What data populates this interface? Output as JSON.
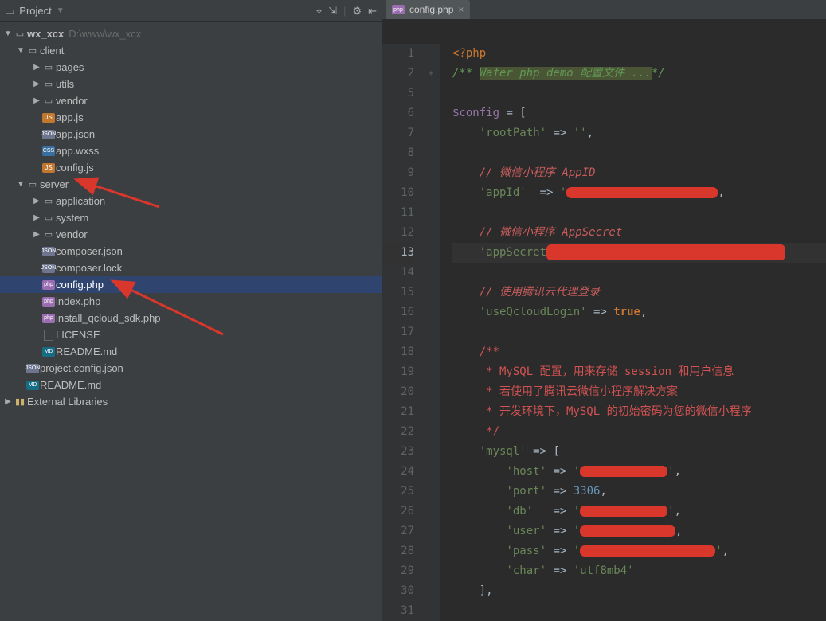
{
  "sidebar": {
    "title": "Project",
    "tool_icons": [
      "target-icon",
      "collapse-icon",
      "gear-icon",
      "hide-icon"
    ]
  },
  "tree": {
    "root": {
      "label": "wx_xcx",
      "hint": "D:\\www\\wx_xcx"
    },
    "client": {
      "label": "client"
    },
    "client_items": {
      "pages": "pages",
      "utils": "utils",
      "vendor": "vendor",
      "app_js": "app.js",
      "app_json": "app.json",
      "app_wxss": "app.wxss",
      "config_js": "config.js"
    },
    "server": {
      "label": "server"
    },
    "server_items": {
      "application": "application",
      "system": "system",
      "vendor": "vendor",
      "composer_json": "composer.json",
      "composer_lock": "composer.lock",
      "config_php": "config.php",
      "index_php": "index.php",
      "install_sdk": "install_qcloud_sdk.php",
      "license": "LICENSE",
      "readme_md": "README.md"
    },
    "root_files": {
      "project_config": "project.config.json",
      "readme_md": "README.md"
    },
    "external_libs": "External Libraries"
  },
  "tab": {
    "label": "config.php"
  },
  "code": {
    "line_start": 1,
    "l1": "<?php",
    "l2_fold": "+",
    "l2_a": "/** ",
    "l2_b": "Wafer php demo 配置文件 ...",
    "l2_c": "*/",
    "l5": "",
    "l6a": "$config",
    "l6b": " = [",
    "l7a": "'rootPath'",
    "l7b": " => ",
    "l7c": "''",
    "l7d": ",",
    "l8": "",
    "l9": "// 微信小程序 AppID",
    "l10a": "'appId'",
    "l10b": "  => ",
    "l10c": "'",
    "l10d": "",
    "l10e": ",",
    "l11": "",
    "l12": "// 微信小程序 AppSecret",
    "l13a": "'appSecret",
    "l14": "",
    "l15": "// 使用腾讯云代理登录",
    "l16a": "'useQcloudLogin'",
    "l16b": " => ",
    "l16c": "true",
    "l16d": ",",
    "l17": "",
    "l18": "/**",
    "l19": " * MySQL 配置，用来存储 session 和用户信息",
    "l20": " * 若使用了腾讯云微信小程序解决方案",
    "l21": " * 开发环境下，MySQL 的初始密码为您的微信小程序",
    "l22": " */",
    "l23a": "'mysql'",
    "l23b": " => [",
    "l24a": "'host'",
    "l24b": " => ",
    "l24c": "'",
    "l24d": "'",
    "l24e": ",",
    "l25a": "'port'",
    "l25b": " => ",
    "l25c": "3306",
    "l25d": ",",
    "l26a": "'db'",
    "l26b": "   => ",
    "l26c": "'",
    "l26d": "'",
    "l26e": ",",
    "l27a": "'user'",
    "l27b": " => ",
    "l27c": "'",
    "l27d": ",",
    "l28a": "'pass'",
    "l28b": " => ",
    "l28c": "'",
    "l28d": "'",
    "l28e": ",",
    "l29a": "'char'",
    "l29b": " => ",
    "l29c": "'utf8mb4'",
    "l30": "],"
  },
  "line_numbers": [
    1,
    2,
    5,
    6,
    7,
    8,
    9,
    10,
    11,
    12,
    13,
    14,
    15,
    16,
    17,
    18,
    19,
    20,
    21,
    22,
    23,
    24,
    25,
    26,
    27,
    28,
    29,
    30,
    31
  ]
}
